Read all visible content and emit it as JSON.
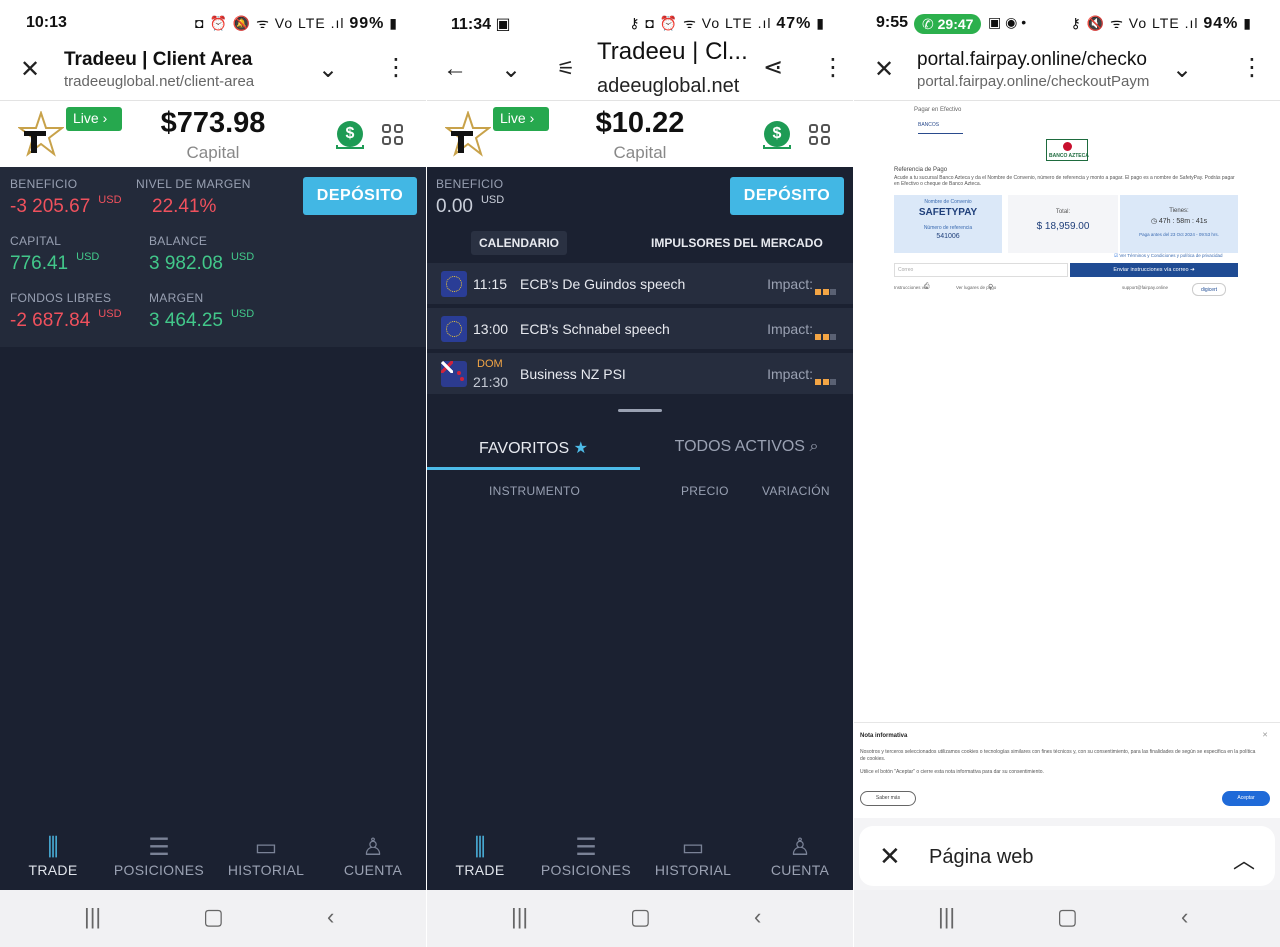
{
  "panel1": {
    "status": {
      "time": "10:13",
      "icons": "◘ ⏰ 🔕 ᯤ Vo LTE .ıl",
      "battery": "99%"
    },
    "browser": {
      "title": "Tradeeu | Client Area",
      "url": "tradeeuglobal.net/client-area"
    },
    "account": {
      "live": "Live",
      "amount": "$773.98",
      "amount_label": "Capital"
    },
    "stats": {
      "beneficio_label": "BENEFICIO",
      "beneficio_value": "-3 205.67",
      "beneficio_cur": "USD",
      "nivel_label": "NIVEL DE MARGEN",
      "nivel_value": "22.41%",
      "capital_label": "CAPITAL",
      "capital_value": "776.41",
      "capital_cur": "USD",
      "balance_label": "BALANCE",
      "balance_value": "3 982.08",
      "balance_cur": "USD",
      "fondos_label": "FONDOS LIBRES",
      "fondos_value": "-2 687.84",
      "fondos_cur": "USD",
      "margen_label": "MARGEN",
      "margen_value": "3 464.25",
      "margen_cur": "USD"
    },
    "deposit": "DEPÓSITO"
  },
  "panel2": {
    "status": {
      "time": "11:34",
      "icons": "⚷ ◘ ⏰ ᯤ Vo LTE .ıl",
      "battery": "47%"
    },
    "browser": {
      "title": "Tradeeu | Cl...",
      "url": "adeeuglobal.net"
    },
    "account": {
      "live": "Live",
      "amount": "$10.22",
      "amount_label": "Capital"
    },
    "beneficio_label": "BENEFICIO",
    "beneficio_value": "0.00",
    "beneficio_cur": "USD",
    "deposit": "DEPÓSITO",
    "tabs": {
      "calendar": "CALENDARIO",
      "drivers": "IMPULSORES DEL MERCADO"
    },
    "events": [
      {
        "time": "11:15",
        "name": "ECB's De Guindos speech",
        "impact": "Impact:"
      },
      {
        "time": "13:00",
        "name": "ECB's Schnabel speech",
        "impact": "Impact:"
      },
      {
        "day": "DOM",
        "time": "21:30",
        "name": "Business NZ PSI",
        "impact": "Impact:"
      }
    ],
    "fav_tab": "FAVORITOS",
    "all_tab": "TODOS ACTIVOS",
    "table_headers": {
      "instrument": "INSTRUMENTO",
      "price": "PRECIO",
      "change": "VARIACIÓN"
    }
  },
  "nav": {
    "trade": "TRADE",
    "positions": "POSICIONES",
    "history": "HISTORIAL",
    "account": "CUENTA"
  },
  "panel3": {
    "status": {
      "time": "9:55",
      "call": "29:47",
      "icons": "⚷ 🔇 ᯤ Vo LTE .ıl",
      "battery": "94%"
    },
    "browser": {
      "title": "portal.fairpay.online/checko",
      "url": "portal.fairpay.online/checkoutPaym"
    },
    "web": {
      "tab1": "Pagar en Efectivo",
      "tab2": "BANCOS",
      "bank_logo": "BANCO AZTECA",
      "ref_title": "Referencia de Pago",
      "desc": "Acude a tu sucursal Banco Azteca y da el Nombre de Convenio, número de referencia y monto a pagar. El pago es a nombre de SafetyPay. Podrás pagar en Efectivo o cheque de Banco Azteca.",
      "convenio_label": "Nombre de Convenio",
      "convenio_value": "SAFETYPAY",
      "ref_label": "Número de referencia",
      "ref_value": "541006",
      "total_label": "Total:",
      "total_value": "$ 18,959.00",
      "time_label": "Tienes:",
      "time_value": "47h : 58m : 41s",
      "deadline": "Paga antes del 23 Oct 2024 - 09:53 hrs.",
      "terms": "Ver Términos y Condiciones y política de privacidad",
      "email_placeholder": "Correo",
      "send_button": "Enviar instrucciones vía correo",
      "instr": "Instrucciones vía",
      "places": "Ver lugares de pago",
      "support": "support@fairpay.online",
      "digicert": "digicert"
    },
    "cookie": {
      "title": "Nota informativa",
      "body": "Nosotros y terceros seleccionados utilizamos cookies o tecnologías similares con fines técnicos y, con su consentimiento, para las finalidades de según se especifica en la política de cookies.",
      "body2": "Utilice el botón \"Aceptar\" o cierre esta nota informativa para dar su consentimiento.",
      "more": "Saber más",
      "accept": "Aceptar"
    },
    "sheet_label": "Página web"
  },
  "colors": {
    "accent": "#42b7e4",
    "negative": "#f0515d",
    "positive": "#42c88a",
    "live": "#26a84e",
    "background": "#1b2131"
  }
}
